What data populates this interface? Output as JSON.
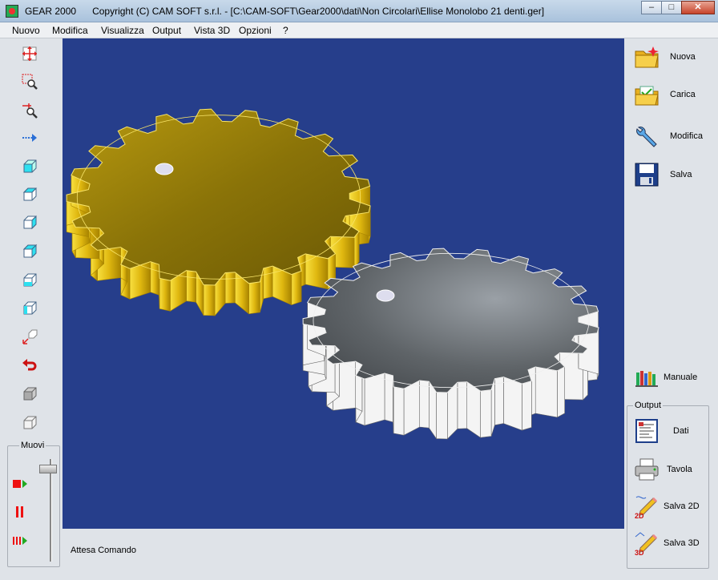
{
  "window": {
    "app_name": "GEAR 2000",
    "title_rest": "Copyright (C)  CAM SOFT s.r.l. - [C:\\CAM-SOFT\\Gear2000\\dati\\Non Circolari\\Ellise Monolobo 21 denti.ger]",
    "minimize": "–",
    "maximize": "□",
    "close": "✕"
  },
  "menu": [
    "Nuovo",
    "Modifica",
    "Visualizza",
    "Output",
    "Vista 3D",
    "Opzioni",
    "?"
  ],
  "left_toolbar": {
    "tools": [
      "move-view-icon",
      "zoom-window-icon",
      "zoom-in-out-icon",
      "pan-arrow-icon",
      "view-top-cube-icon",
      "view-front-cube-icon",
      "view-side-cube-icon",
      "view-iso-cube-icon",
      "view-wire-cube-icon",
      "view-back-cube-icon",
      "axis-rotate-icon",
      "undo-red-icon",
      "solid-cube-icon",
      "wire-cube-icon"
    ],
    "muovi_label": "Muovi",
    "muovi_level": 0.05
  },
  "status": {
    "text": "Attesa Comando"
  },
  "right_toolbar": {
    "top": [
      {
        "label": "Nuova",
        "icon": "new-folder-icon"
      },
      {
        "label": "Carica",
        "icon": "open-folder-icon"
      },
      {
        "label": "Modifica",
        "icon": "wrench-icon"
      },
      {
        "label": "Salva",
        "icon": "floppy-disk-icon"
      }
    ],
    "manuale": {
      "label": "Manuale",
      "icon": "books-icon"
    },
    "output_label": "Output",
    "output": [
      {
        "label": "Dati",
        "icon": "data-sheet-icon"
      },
      {
        "label": "Tavola",
        "icon": "printer-icon"
      },
      {
        "label": "Salva 2D",
        "icon": "pencil-2d-icon"
      },
      {
        "label": "Salva 3D",
        "icon": "pencil-3d-icon"
      }
    ]
  },
  "colors": {
    "viewport_bg": "#263e8b",
    "gear_gold": "#f2d21c",
    "gear_gray": "#6a6e72"
  }
}
